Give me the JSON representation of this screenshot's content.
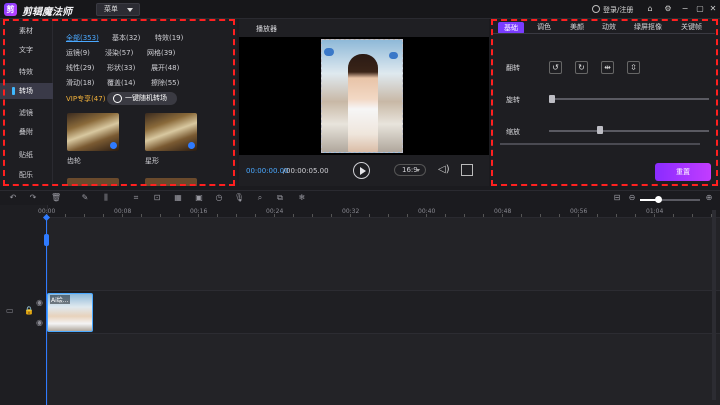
{
  "app": {
    "logo_glyph": "剪",
    "title": "剪辑魔法师",
    "menu_label": "菜单",
    "login_label": "登录/注册"
  },
  "window_controls": [
    "home-icon",
    "settings-icon",
    "minimize-icon",
    "restore-icon",
    "close-icon"
  ],
  "categories": [
    {
      "label": "素材",
      "active": false
    },
    {
      "label": "文字",
      "active": false
    },
    {
      "label": "特效",
      "active": false
    },
    {
      "label": "转场",
      "active": true
    },
    {
      "label": "滤镜",
      "active": false
    },
    {
      "label": "叠附",
      "active": false
    },
    {
      "label": "贴纸",
      "active": false
    },
    {
      "label": "配乐",
      "active": false
    }
  ],
  "filters": {
    "all": "全部(353)",
    "basic": "基本(32)",
    "special": "特效(19)",
    "motion": "运镜(9)",
    "ink": "浸染(57)",
    "grid": "网格(39)",
    "linear": "线性(29)",
    "shape": "形状(33)",
    "unfold": "展开(48)",
    "slide": "滑动(18)",
    "cover": "覆盖(14)",
    "erase": "擦除(55)",
    "vip": "VIP专享(47)"
  },
  "random_button_label": "一键随机转场",
  "thumbnails": [
    {
      "label": "齿轮"
    },
    {
      "label": "星形"
    }
  ],
  "player": {
    "title": "播放器",
    "current_time": "00:00:00.00",
    "separator": "/",
    "total_time": "00:00:05.00",
    "ratio_label": "16:9"
  },
  "right_tabs": [
    {
      "label": "基础",
      "active": true
    },
    {
      "label": "调色",
      "active": false
    },
    {
      "label": "美颜",
      "active": false
    },
    {
      "label": "动效",
      "active": false
    },
    {
      "label": "绿屏抠像",
      "active": false
    },
    {
      "label": "关键帧",
      "active": false
    }
  ],
  "properties": {
    "flip_label": "翻转",
    "rotate_label": "旋转",
    "scale_label": "缩放",
    "rotate_value": 0,
    "scale_value": 0.3
  },
  "reset_label": "重置",
  "ruler_labels": [
    "00:00",
    "00:08",
    "00:16",
    "00:24",
    "00:32",
    "00:40",
    "00:48",
    "00:56",
    "01:04"
  ],
  "clip": {
    "label": "Ai绘..."
  }
}
